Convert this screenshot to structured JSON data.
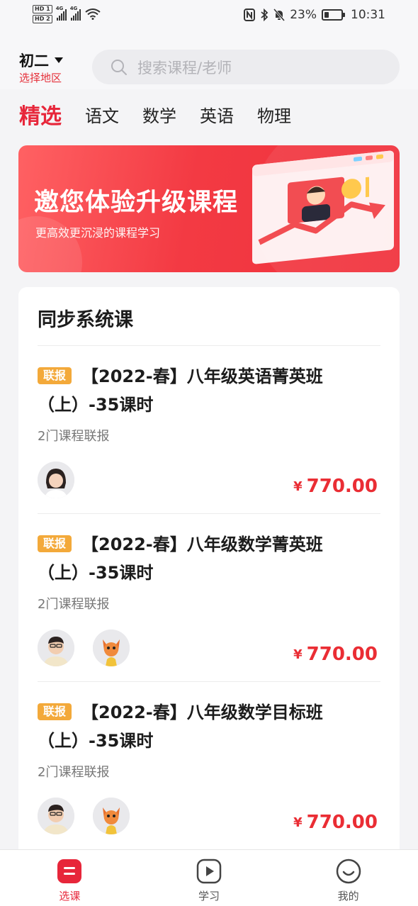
{
  "status_bar": {
    "hd1": "HD 1",
    "hd2": "HD 2",
    "net1": "4G",
    "net2": "4G",
    "battery_text": "23%",
    "battery_level": 0.23,
    "time": "10:31"
  },
  "header": {
    "grade": "初二",
    "region": "选择地区",
    "search_placeholder": "搜索课程/老师"
  },
  "tabs": [
    "精选",
    "语文",
    "数学",
    "英语",
    "物理"
  ],
  "banner": {
    "title": "邀您体验升级课程",
    "subtitle": "更高效更沉浸的课程学习"
  },
  "section": {
    "title": "同步系统课",
    "courses": [
      {
        "badge": "联报",
        "title": "【2022-春】八年级英语菁英班（上）-35课时",
        "subtitle": "2门课程联报",
        "price_symbol": "¥",
        "price": "770.00",
        "avatars": [
          "teacher-female-avatar"
        ]
      },
      {
        "badge": "联报",
        "title": "【2022-春】八年级数学菁英班（上）-35课时",
        "subtitle": "2门课程联报",
        "price_symbol": "¥",
        "price": "770.00",
        "avatars": [
          "teacher-male-avatar",
          "mascot-avatar"
        ]
      },
      {
        "badge": "联报",
        "title": "【2022-春】八年级数学目标班（上）-35课时",
        "subtitle": "2门课程联报",
        "price_symbol": "¥",
        "price": "770.00",
        "avatars": [
          "teacher-male-avatar",
          "mascot-avatar"
        ]
      }
    ]
  },
  "bottom_nav": [
    {
      "label": "选课",
      "icon": "course-select-icon",
      "active": true
    },
    {
      "label": "学习",
      "icon": "play-icon",
      "active": false
    },
    {
      "label": "我的",
      "icon": "profile-smile-icon",
      "active": false
    }
  ],
  "colors": {
    "accent": "#e7263a",
    "price": "#ea2d34",
    "badge": "#f3a93a",
    "banner": "#f33a43"
  }
}
